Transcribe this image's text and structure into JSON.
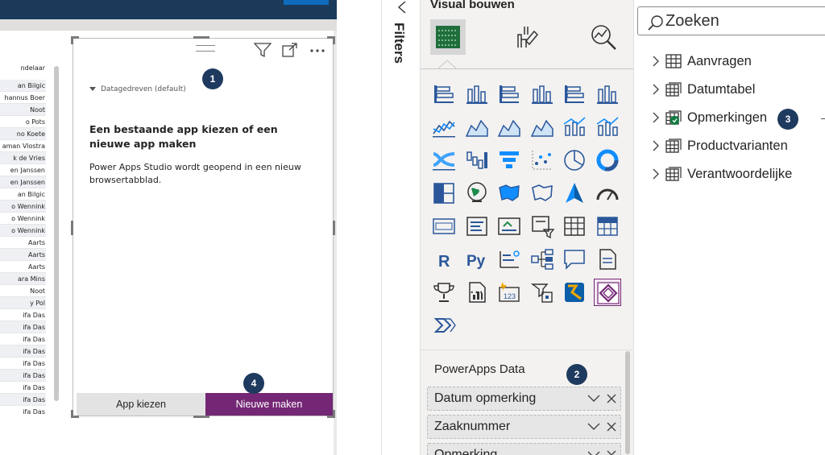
{
  "table": {
    "header": "ndelaar",
    "rows": [
      "an Bilgic",
      "hannus Boer",
      "Noot",
      "o Pots",
      "no Koete",
      "aman Vlostra",
      "k de Vries",
      "en Janssen",
      "en Janssen",
      "an Bilgic",
      "o Wennink",
      "o Wennink",
      "o Wennink",
      "Aarts",
      "Aarts",
      "Aarts",
      "ara Mins",
      "Noot",
      "y Pol",
      "ifa Das",
      "ifa Das",
      "ifa Das",
      "ifa Das",
      "ifa Das",
      "ifa Das",
      "ifa Das",
      "ifa Das",
      "ifa Das"
    ]
  },
  "powerapps_visual": {
    "dropdown_label": "Datagedreven (default)",
    "heading": "Een bestaande app kiezen of een nieuwe app maken",
    "body": "Power Apps Studio wordt geopend in een nieuw browsertabblad.",
    "choose_button": "App kiezen",
    "new_button": "Nieuwe maken"
  },
  "badges": {
    "one": "1",
    "two": "2",
    "three": "3",
    "four": "4"
  },
  "filters": {
    "label": "Filters",
    "icon": "filter-icon"
  },
  "visualizations": {
    "title": "Visual bouwen",
    "top_icons": [
      "build-visual-icon",
      "format-visual-icon",
      "analytics-icon"
    ],
    "more_label": "···",
    "fields_title": "PowerApps Data",
    "fields": [
      "Datum opmerking",
      "Zaaknummer",
      "Opmerking"
    ]
  },
  "data": {
    "search_placeholder": "Zoeken",
    "tables": [
      "Aanvragen",
      "Datumtabel",
      "Opmerkingen",
      "Productvarianten",
      "Verantwoordelijke"
    ]
  },
  "colors": {
    "accent": "#742774",
    "badge": "#1e3a5f",
    "header": "#1b3a5a",
    "teal": "#118dff",
    "check": "#107c41"
  }
}
